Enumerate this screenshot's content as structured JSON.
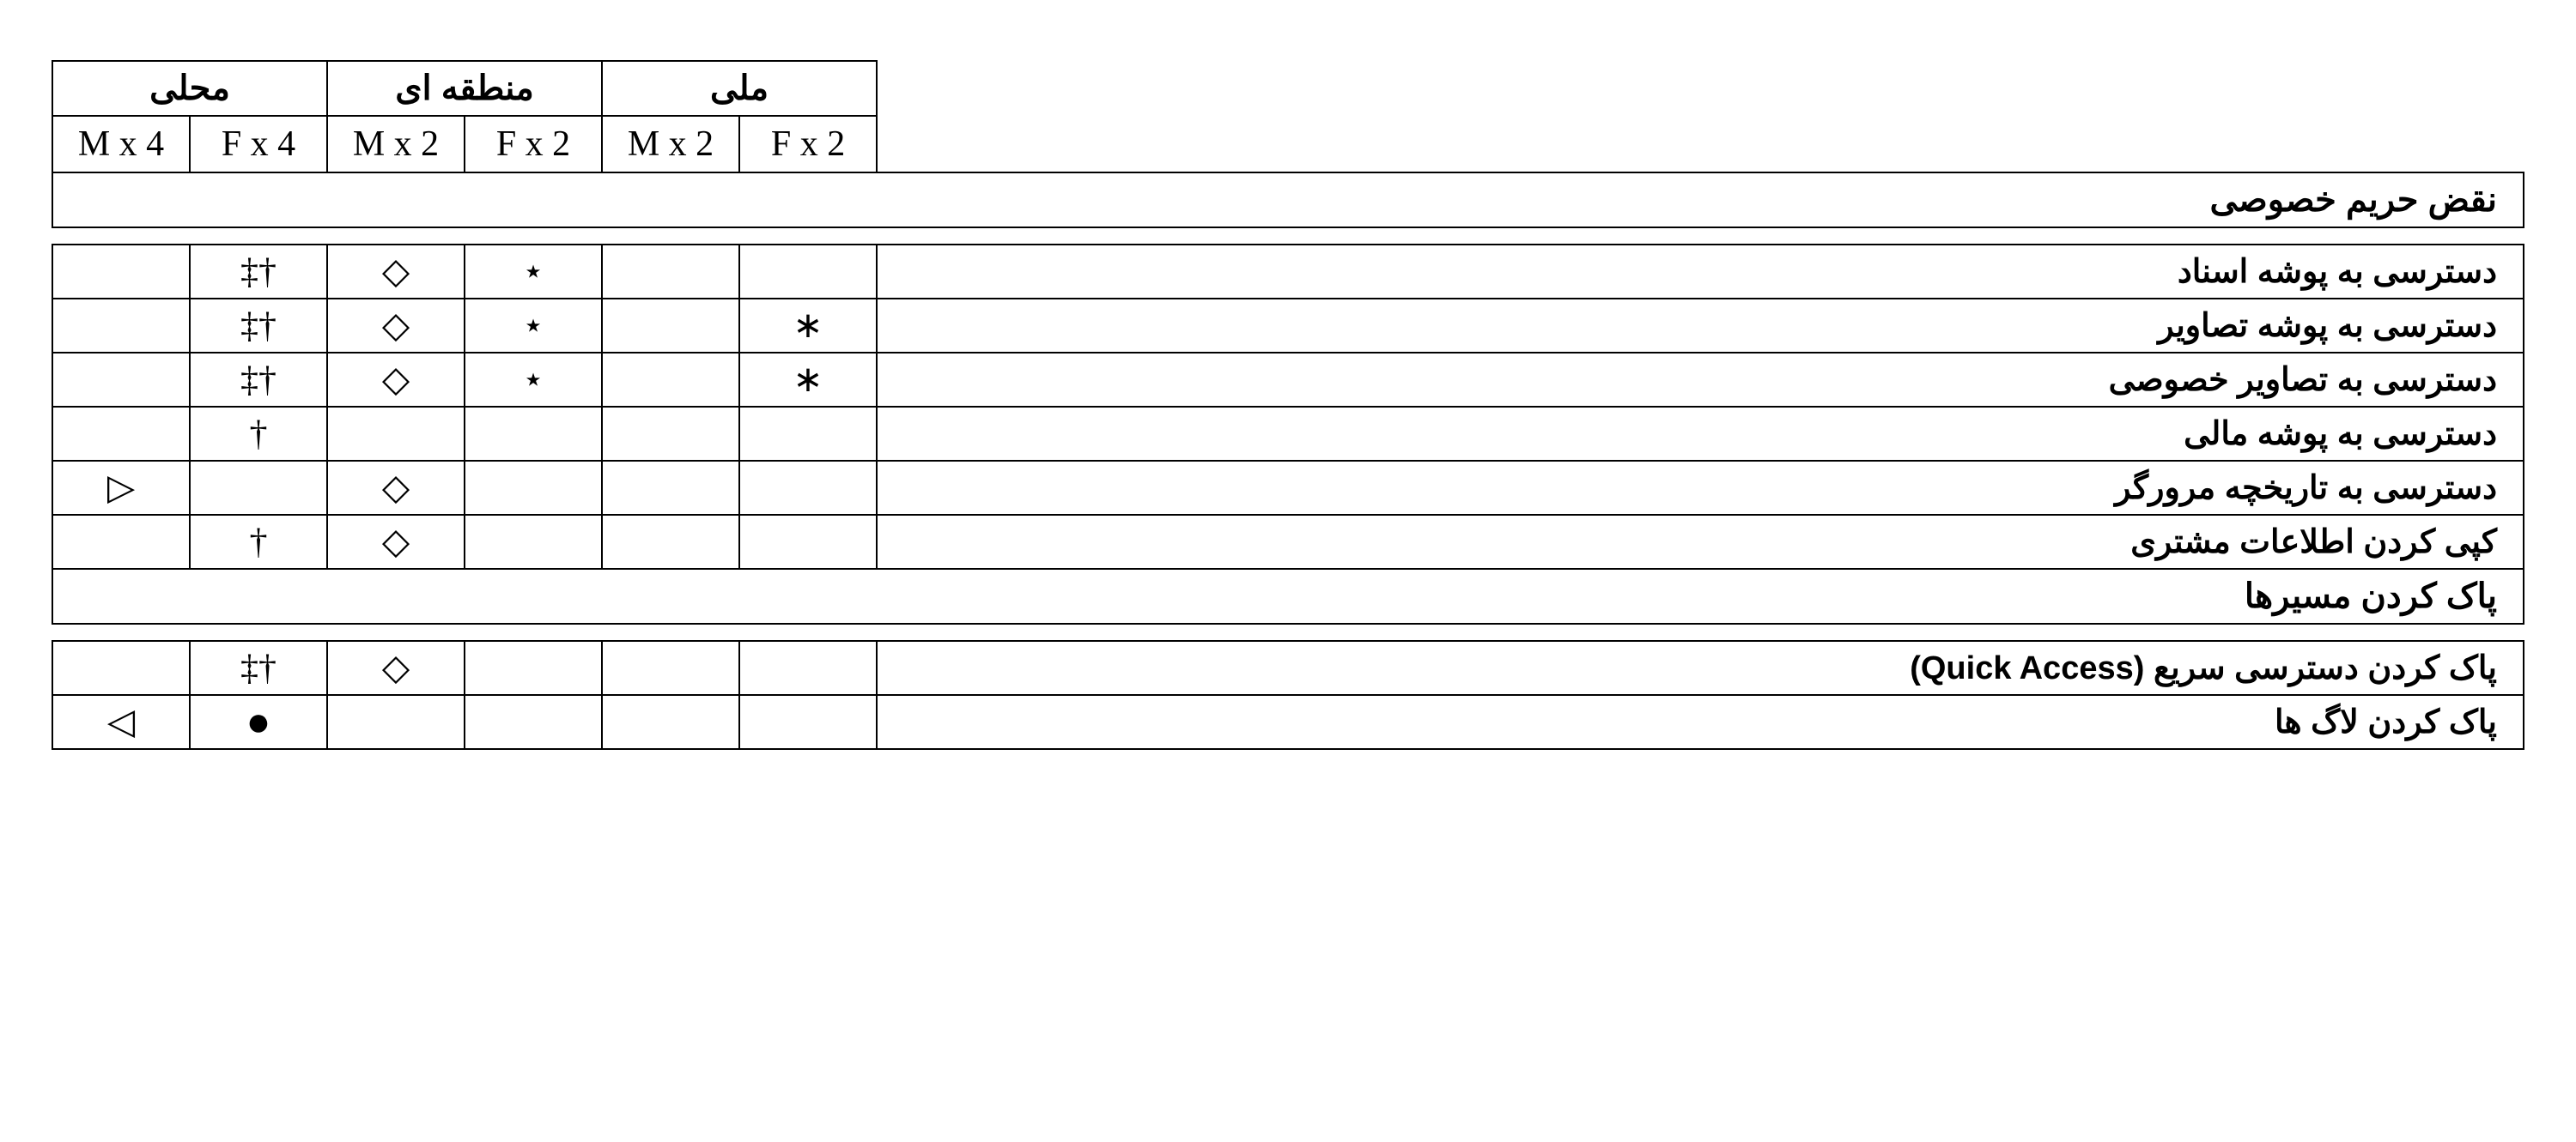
{
  "header": {
    "scopes": {
      "local": "محلی",
      "regional": "منطقه ای",
      "national": "ملی"
    },
    "mults": {
      "local_m": "M x 4",
      "local_f": "F x 4",
      "regional_m": "M x 2",
      "regional_f": "F x 2",
      "national_m": "M x 2",
      "national_f": "F x 2"
    }
  },
  "sections": {
    "privacy": "نقض حریم خصوصی",
    "clearing": "پاک کردن مسیرها"
  },
  "rows": {
    "r1": {
      "label": "دسترسی به پوشه اسناد",
      "c": [
        "",
        "‡†",
        "◇",
        "⋆",
        "",
        ""
      ]
    },
    "r2": {
      "label": "دسترسی به پوشه تصاویر",
      "c": [
        "",
        "‡†",
        "◇",
        "⋆",
        "",
        "∗"
      ]
    },
    "r3": {
      "label": "دسترسی به تصاویر خصوصی",
      "c": [
        "",
        "‡†",
        "◇",
        "⋆",
        "",
        "∗"
      ]
    },
    "r4": {
      "label": "دسترسی به پوشه مالی",
      "c": [
        "",
        "†",
        "",
        "",
        "",
        ""
      ]
    },
    "r5": {
      "label": "دسترسی به تاریخچه مرورگر",
      "c": [
        "▷",
        "",
        "◇",
        "",
        "",
        ""
      ]
    },
    "r6": {
      "label": "کپی کردن اطلاعات مشتری",
      "c": [
        "",
        "†",
        "◇",
        "",
        "",
        ""
      ]
    },
    "r7": {
      "label": "پاک کردن دسترسی سریع    (Quick Access)",
      "c": [
        "",
        "‡†",
        "◇",
        "",
        "",
        ""
      ]
    },
    "r8": {
      "label": "پاک کردن  لاگ ها",
      "c": [
        "◁",
        "●",
        "",
        "",
        "",
        ""
      ]
    }
  }
}
